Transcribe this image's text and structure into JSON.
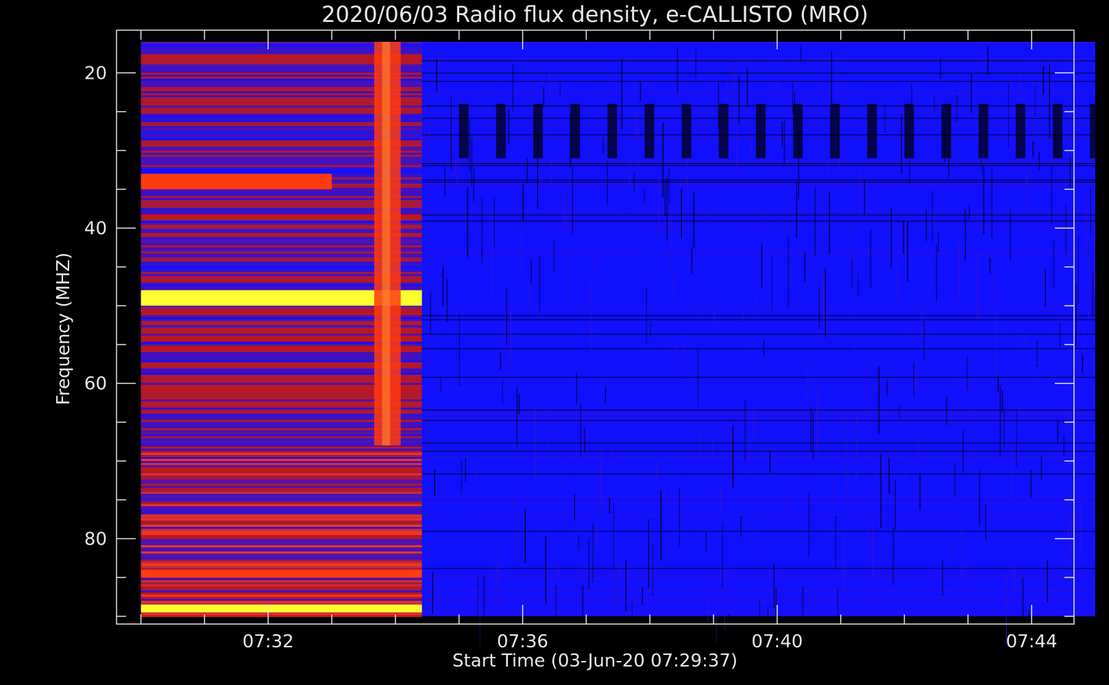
{
  "chart_data": {
    "type": "heatmap",
    "title": "2020/06/03  Radio flux density, e-CALLISTO (MRO)",
    "xlabel": "Start Time (03-Jun-20 07:29:37)",
    "ylabel": "Frequency (MHZ)",
    "x_range": [
      "07:29:37",
      "07:44:40"
    ],
    "ylim": [
      91.0,
      14.5
    ],
    "y_ticks": [
      {
        "value": 20,
        "label": "20"
      },
      {
        "value": 40,
        "label": "40"
      },
      {
        "value": 60,
        "label": "60"
      },
      {
        "value": 80,
        "label": "80"
      }
    ],
    "y_minor_ticks": [
      25,
      30,
      35,
      45,
      50,
      55,
      65,
      70,
      75,
      85,
      90
    ],
    "x_ticks": [
      {
        "time": "07:32",
        "label": "07:32"
      },
      {
        "time": "07:36",
        "label": "07:36"
      },
      {
        "time": "07:40",
        "label": "07:40"
      },
      {
        "time": "07:44",
        "label": "07:44"
      }
    ],
    "x_minor_ticks": [
      "07:30",
      "07:31",
      "07:33",
      "07:34",
      "07:35",
      "07:37",
      "07:38",
      "07:39",
      "07:41",
      "07:42",
      "07:43"
    ],
    "data_time_range": [
      "07:30:00",
      "07:45:00"
    ],
    "data_freq_range": [
      16,
      90
    ],
    "intense_period_end": "07:34:25",
    "colorscale": [
      "#000000",
      "#1010ff",
      "#3a10c8",
      "#c01818",
      "#ff3a10",
      "#ffff30"
    ],
    "bands": [
      {
        "freq_low": 33,
        "freq_high": 35,
        "time_start": "07:30:00",
        "time_end": "07:33:00",
        "level": 0.9
      },
      {
        "freq_low": 48,
        "freq_high": 50,
        "time_start": "07:30:00",
        "time_end": "07:34:25",
        "level": 0.95
      },
      {
        "freq_low": 88.5,
        "freq_high": 89.5,
        "time_start": "07:30:00",
        "time_end": "07:34:25",
        "level": 1.0
      },
      {
        "freq_low": 84,
        "freq_high": 85,
        "time_start": "07:30:00",
        "time_end": "07:34:25",
        "level": 0.9
      }
    ],
    "bursts": [
      {
        "time_start": "07:33:40",
        "time_end": "07:34:05",
        "freq_low": 16,
        "freq_high": 68,
        "level": 0.9
      }
    ]
  }
}
